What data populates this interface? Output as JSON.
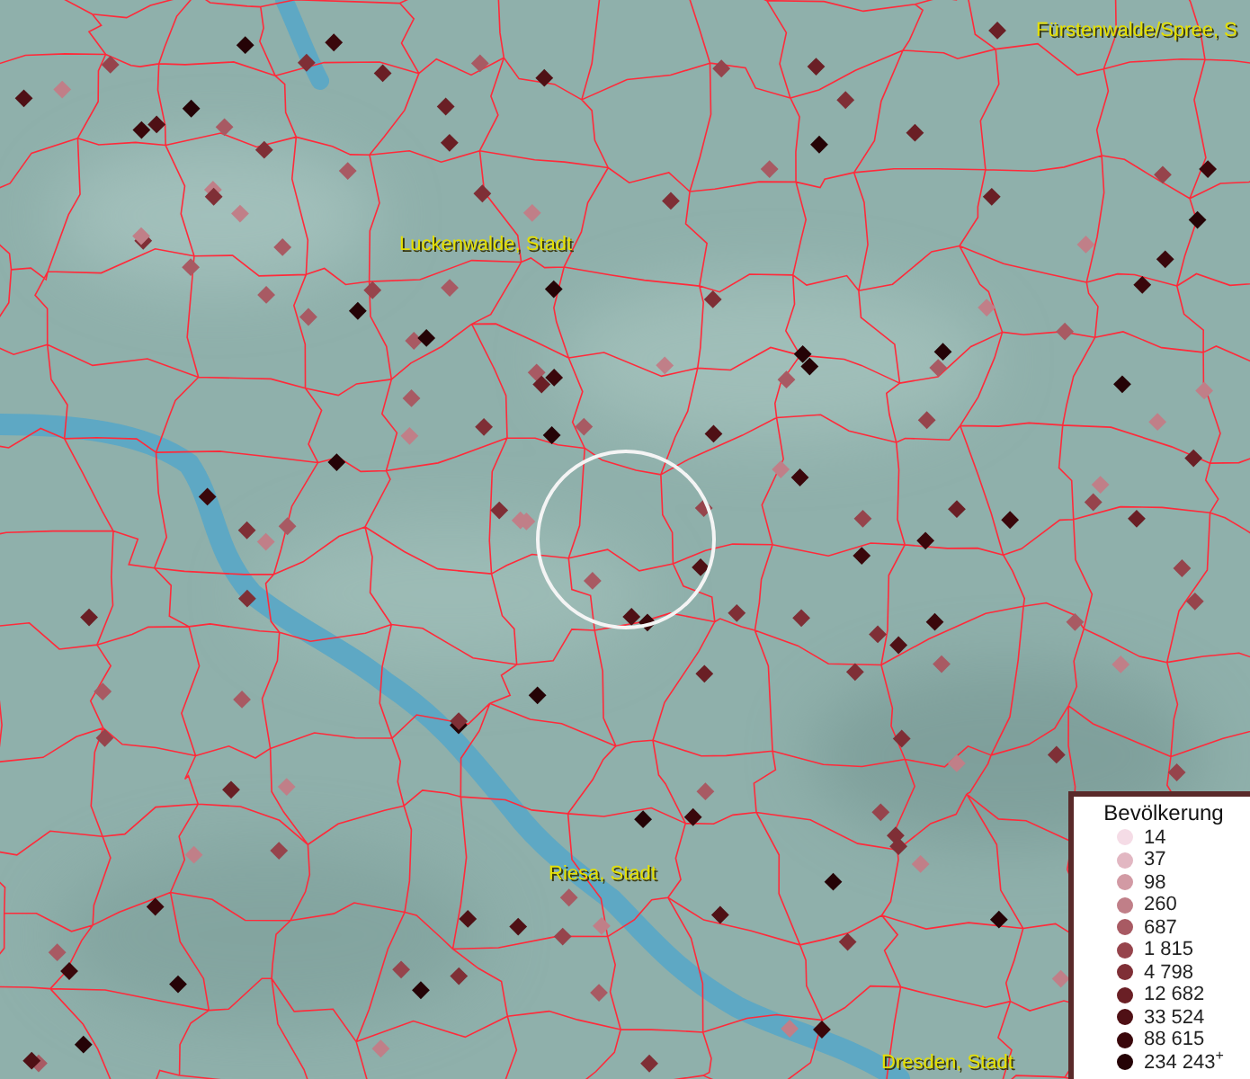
{
  "map": {
    "labels": [
      {
        "text": "Fürstenwalde/Spree, S"
      },
      {
        "text": "Luckenwalde, Stadt"
      },
      {
        "text": "Riesa, Stadt"
      },
      {
        "text": "Dresden, Stadt"
      }
    ]
  },
  "legend": {
    "title": "Bevölkerung",
    "entries": [
      {
        "label": "14",
        "color": "#f5dce6"
      },
      {
        "label": "37",
        "color": "#e2b7c2"
      },
      {
        "label": "98",
        "color": "#d29aa4"
      },
      {
        "label": "260",
        "color": "#c07f88"
      },
      {
        "label": "687",
        "color": "#a85a63"
      },
      {
        "label": "1 815",
        "color": "#96444c"
      },
      {
        "label": "4 798",
        "color": "#7f2f36"
      },
      {
        "label": "12 682",
        "color": "#6a1f25"
      },
      {
        "label": "33 524",
        "color": "#4f1015"
      },
      {
        "label": "88 615",
        "color": "#3a070b"
      },
      {
        "label": "234 243$^{+}$",
        "color": "#250306"
      }
    ]
  }
}
